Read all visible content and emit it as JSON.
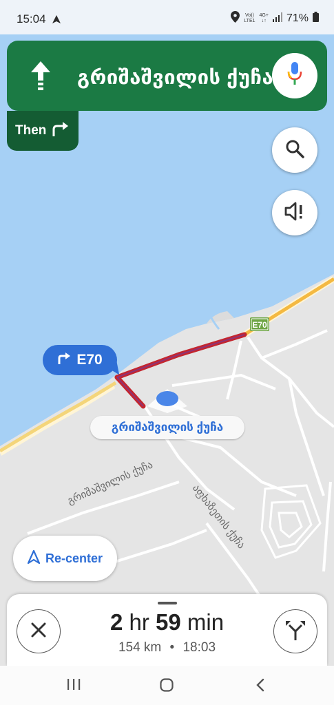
{
  "status_bar": {
    "time": "15:04",
    "volte_top": "Vo))",
    "volte_bottom": "LTE1",
    "network_top": "4G+",
    "network_bottom": "↓↑",
    "battery": "71%"
  },
  "nav_banner": {
    "street": "გრიშაშვილის ქუჩა",
    "direction_icon": "straight-arrow",
    "mic_icon": "google-mic"
  },
  "then": {
    "label": "Then",
    "icon": "turn-right"
  },
  "map": {
    "turn_callout": "E70",
    "road_shield": "E70",
    "current_street": "გრიშაშვილის ქუჩა",
    "labels": {
      "street_a": "გრიშაშვილის ქუჩა",
      "street_b": "აფხაზეთის ქუჩა"
    }
  },
  "recenter": {
    "label": "Re-center"
  },
  "trip": {
    "hours": "2",
    "hours_unit": "hr",
    "minutes": "59",
    "minutes_unit": "min",
    "distance": "154 km",
    "separator": "•",
    "arrival": "18:03"
  },
  "colors": {
    "nav_green": "#1b7a44",
    "route_red": "#c4262e",
    "route_blue": "#2f6fd6",
    "water": "#a6d0f5",
    "land": "#e5e5e5",
    "highway": "#f4b942"
  }
}
